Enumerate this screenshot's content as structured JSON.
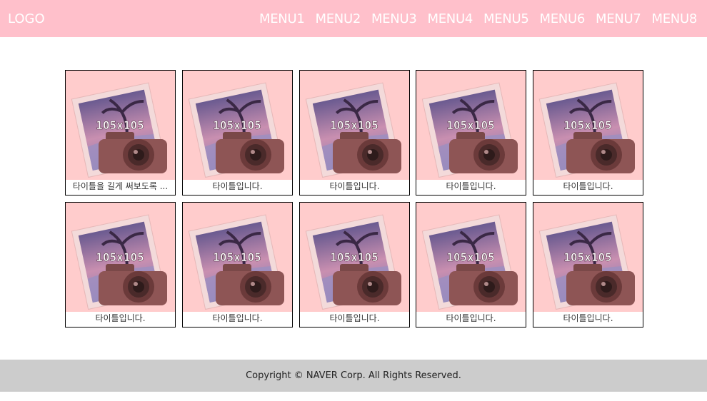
{
  "header": {
    "logo": "LOGO",
    "menu": [
      "MENU1",
      "MENU2",
      "MENU3",
      "MENU4",
      "MENU5",
      "MENU6",
      "MENU7",
      "MENU8"
    ]
  },
  "gallery": {
    "placeholder_label": "105x105",
    "items": [
      {
        "title": "타이틀을 길게 써보도록 ..."
      },
      {
        "title": "타이틀입니다."
      },
      {
        "title": "타이틀입니다."
      },
      {
        "title": "타이틀입니다."
      },
      {
        "title": "타이틀입니다."
      },
      {
        "title": "타이틀입니다."
      },
      {
        "title": "타이틀입니다."
      },
      {
        "title": "타이틀입니다."
      },
      {
        "title": "타이틀입니다."
      },
      {
        "title": "타이틀입니다."
      }
    ]
  },
  "footer": {
    "copyright": "Copyright © NAVER Corp. All Rights Reserved."
  },
  "colors": {
    "header_bg": "#ffc0cb",
    "thumb_bg": "#ffcccc",
    "footer_bg": "#cccccc"
  }
}
